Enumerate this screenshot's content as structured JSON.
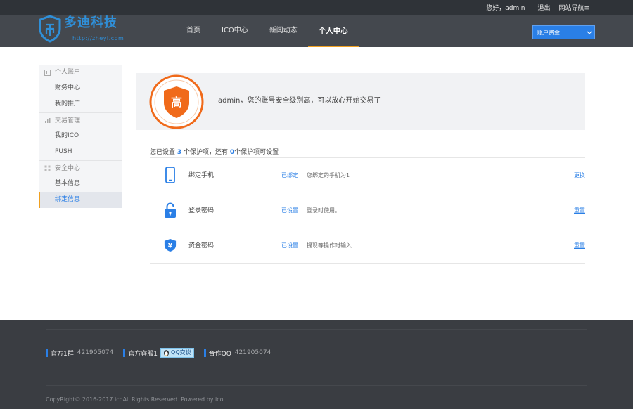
{
  "topbar": {
    "greeting": "您好，admin",
    "logout": "退出",
    "site_nav": "网站导航≡"
  },
  "brand": {
    "name": "多迪科技",
    "url": "http://zheyi.com",
    "color": "#2f8fd8"
  },
  "nav": {
    "items": [
      "首页",
      "ICO中心",
      "新闻动态",
      "个人中心"
    ],
    "active": "个人中心"
  },
  "account_select": {
    "value": "账户资金"
  },
  "sidebar": {
    "groups": [
      {
        "label": "个人账户",
        "icon": "doc-icon",
        "items": [
          "财务中心",
          "我的推广"
        ]
      },
      {
        "label": "交易管理",
        "icon": "chart-icon",
        "items": [
          "我的ICO",
          "PUSH"
        ]
      },
      {
        "label": "安全中心",
        "icon": "grid-icon",
        "items": [
          "基本信息",
          "绑定信息"
        ]
      }
    ],
    "active_item": "绑定信息"
  },
  "security": {
    "level_char": "高",
    "message": "admin，您的账号安全级别高，可以放心开始交易了",
    "summary_prefix": "您已设置 ",
    "set_count": "3",
    "summary_mid": " 个保护项，还有 ",
    "unset_count": "0",
    "summary_suffix": "个保护项可设置",
    "badge_color": "#f06a1a"
  },
  "protection_items": [
    {
      "name": "绑定手机",
      "status": "已绑定",
      "desc": "您绑定的手机为1",
      "action": "更换",
      "icon": "phone-icon"
    },
    {
      "name": "登录密码",
      "status": "已设置",
      "desc": "登录时使用。",
      "action": "重置",
      "icon": "lock-icon"
    },
    {
      "name": "资金密码",
      "status": "已设置",
      "desc": "提现等操作时输入",
      "action": "重置",
      "icon": "yen-shield-icon"
    }
  ],
  "footer": {
    "contacts": [
      {
        "label": "官方1群",
        "value": "421905074"
      },
      {
        "label": "官方客服1",
        "button": "QQ交谈"
      },
      {
        "label": "合作QQ",
        "value": "421905074"
      }
    ],
    "copyright": "CopyRight© 2016-2017 icoAll Rights Reserved. Powered by ico"
  },
  "colors": {
    "accent": "#2a7fe6",
    "nav_active": "#f0a020",
    "header_bg": "#44484e",
    "footer_bg": "#3a3d42"
  }
}
